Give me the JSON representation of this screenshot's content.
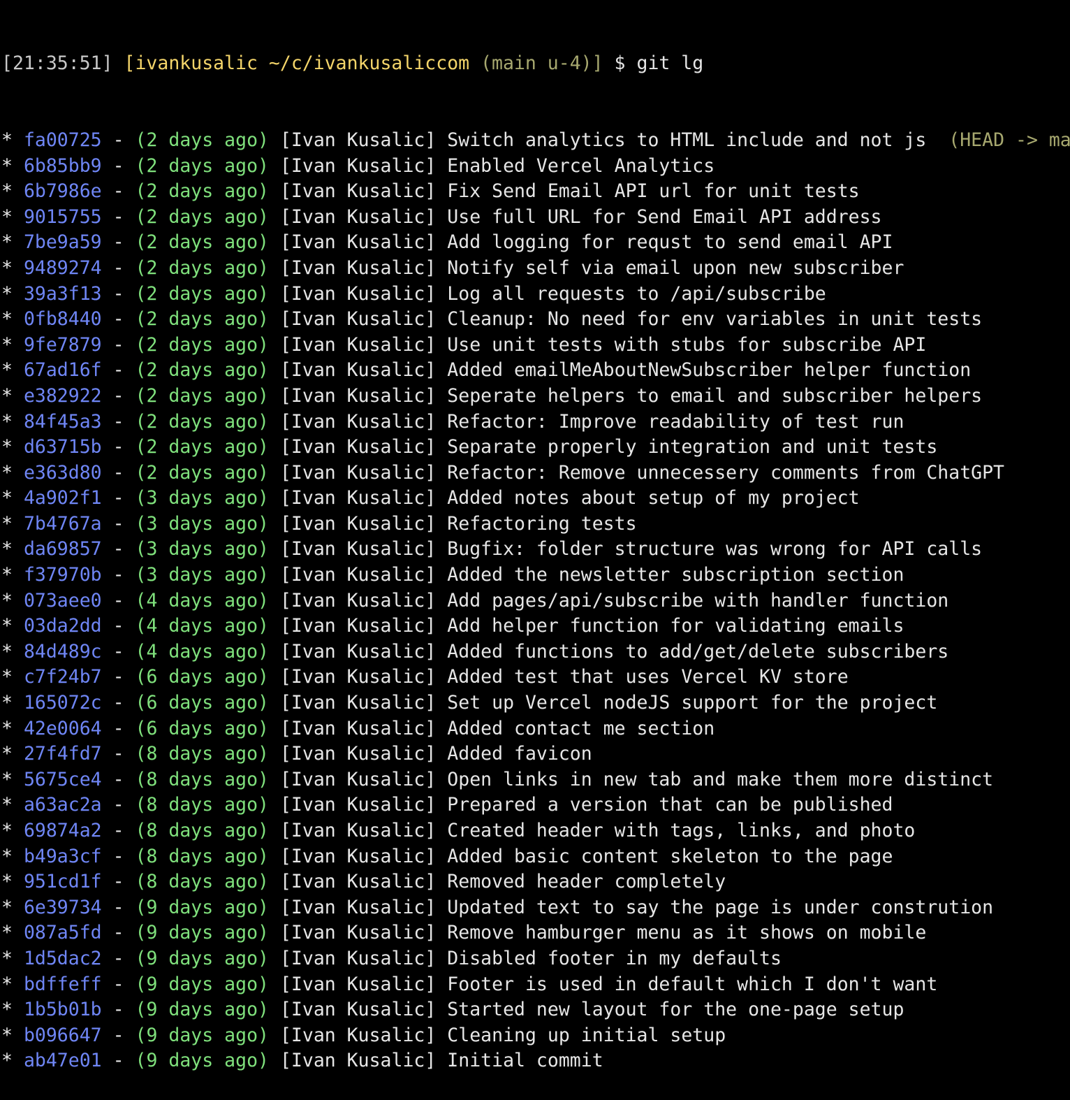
{
  "prompt": {
    "time": "[21:35:51]",
    "user_path": "[ivankusalic ~/c/ivankusaliccom",
    "branch": "(main u-4)]",
    "symbol": "$",
    "command": "git lg"
  },
  "commits": [
    {
      "graph": "*",
      "hash": "fa00725",
      "date": "(2 days ago)",
      "author": "[Ivan Kusalic]",
      "message": "Switch analytics to HTML include and not js",
      "refs": "(HEAD -> main)"
    },
    {
      "graph": "*",
      "hash": "6b85bb9",
      "date": "(2 days ago)",
      "author": "[Ivan Kusalic]",
      "message": "Enabled Vercel Analytics",
      "refs": ""
    },
    {
      "graph": "*",
      "hash": "6b7986e",
      "date": "(2 days ago)",
      "author": "[Ivan Kusalic]",
      "message": "Fix Send Email API url for unit tests",
      "refs": ""
    },
    {
      "graph": "*",
      "hash": "9015755",
      "date": "(2 days ago)",
      "author": "[Ivan Kusalic]",
      "message": "Use full URL for Send Email API address",
      "refs": ""
    },
    {
      "graph": "*",
      "hash": "7be9a59",
      "date": "(2 days ago)",
      "author": "[Ivan Kusalic]",
      "message": "Add logging for requst to send email API",
      "refs": ""
    },
    {
      "graph": "*",
      "hash": "9489274",
      "date": "(2 days ago)",
      "author": "[Ivan Kusalic]",
      "message": "Notify self via email upon new subscriber",
      "refs": ""
    },
    {
      "graph": "*",
      "hash": "39a3f13",
      "date": "(2 days ago)",
      "author": "[Ivan Kusalic]",
      "message": "Log all requests to /api/subscribe",
      "refs": ""
    },
    {
      "graph": "*",
      "hash": "0fb8440",
      "date": "(2 days ago)",
      "author": "[Ivan Kusalic]",
      "message": "Cleanup: No need for env variables in unit tests",
      "refs": ""
    },
    {
      "graph": "*",
      "hash": "9fe7879",
      "date": "(2 days ago)",
      "author": "[Ivan Kusalic]",
      "message": "Use unit tests with stubs for subscribe API",
      "refs": ""
    },
    {
      "graph": "*",
      "hash": "67ad16f",
      "date": "(2 days ago)",
      "author": "[Ivan Kusalic]",
      "message": "Added emailMeAboutNewSubscriber helper function",
      "refs": ""
    },
    {
      "graph": "*",
      "hash": "e382922",
      "date": "(2 days ago)",
      "author": "[Ivan Kusalic]",
      "message": "Seperate helpers to email and subscriber helpers",
      "refs": ""
    },
    {
      "graph": "*",
      "hash": "84f45a3",
      "date": "(2 days ago)",
      "author": "[Ivan Kusalic]",
      "message": "Refactor: Improve readability of test run",
      "refs": ""
    },
    {
      "graph": "*",
      "hash": "d63715b",
      "date": "(2 days ago)",
      "author": "[Ivan Kusalic]",
      "message": "Separate properly integration and unit tests",
      "refs": ""
    },
    {
      "graph": "*",
      "hash": "e363d80",
      "date": "(2 days ago)",
      "author": "[Ivan Kusalic]",
      "message": "Refactor: Remove unnecessery comments from ChatGPT",
      "refs": ""
    },
    {
      "graph": "*",
      "hash": "4a902f1",
      "date": "(3 days ago)",
      "author": "[Ivan Kusalic]",
      "message": "Added notes about setup of my project",
      "refs": ""
    },
    {
      "graph": "*",
      "hash": "7b4767a",
      "date": "(3 days ago)",
      "author": "[Ivan Kusalic]",
      "message": "Refactoring tests",
      "refs": ""
    },
    {
      "graph": "*",
      "hash": "da69857",
      "date": "(3 days ago)",
      "author": "[Ivan Kusalic]",
      "message": "Bugfix: folder structure was wrong for API calls",
      "refs": ""
    },
    {
      "graph": "*",
      "hash": "f37970b",
      "date": "(3 days ago)",
      "author": "[Ivan Kusalic]",
      "message": "Added the newsletter subscription section",
      "refs": ""
    },
    {
      "graph": "*",
      "hash": "073aee0",
      "date": "(4 days ago)",
      "author": "[Ivan Kusalic]",
      "message": "Add pages/api/subscribe with handler function",
      "refs": ""
    },
    {
      "graph": "*",
      "hash": "03da2dd",
      "date": "(4 days ago)",
      "author": "[Ivan Kusalic]",
      "message": "Add helper function for validating emails",
      "refs": ""
    },
    {
      "graph": "*",
      "hash": "84d489c",
      "date": "(4 days ago)",
      "author": "[Ivan Kusalic]",
      "message": "Added functions to add/get/delete subscribers",
      "refs": ""
    },
    {
      "graph": "*",
      "hash": "c7f24b7",
      "date": "(6 days ago)",
      "author": "[Ivan Kusalic]",
      "message": "Added test that uses Vercel KV store",
      "refs": ""
    },
    {
      "graph": "*",
      "hash": "165072c",
      "date": "(6 days ago)",
      "author": "[Ivan Kusalic]",
      "message": "Set up Vercel nodeJS support for the project",
      "refs": ""
    },
    {
      "graph": "*",
      "hash": "42e0064",
      "date": "(6 days ago)",
      "author": "[Ivan Kusalic]",
      "message": "Added contact me section",
      "refs": ""
    },
    {
      "graph": "*",
      "hash": "27f4fd7",
      "date": "(8 days ago)",
      "author": "[Ivan Kusalic]",
      "message": "Added favicon",
      "refs": ""
    },
    {
      "graph": "*",
      "hash": "5675ce4",
      "date": "(8 days ago)",
      "author": "[Ivan Kusalic]",
      "message": "Open links in new tab and make them more distinct",
      "refs": ""
    },
    {
      "graph": "*",
      "hash": "a63ac2a",
      "date": "(8 days ago)",
      "author": "[Ivan Kusalic]",
      "message": "Prepared a version that can be published",
      "refs": ""
    },
    {
      "graph": "*",
      "hash": "69874a2",
      "date": "(8 days ago)",
      "author": "[Ivan Kusalic]",
      "message": "Created header with tags, links, and photo",
      "refs": ""
    },
    {
      "graph": "*",
      "hash": "b49a3cf",
      "date": "(8 days ago)",
      "author": "[Ivan Kusalic]",
      "message": "Added basic content skeleton to the page",
      "refs": ""
    },
    {
      "graph": "*",
      "hash": "951cd1f",
      "date": "(8 days ago)",
      "author": "[Ivan Kusalic]",
      "message": "Removed header completely",
      "refs": ""
    },
    {
      "graph": "*",
      "hash": "6e39734",
      "date": "(9 days ago)",
      "author": "[Ivan Kusalic]",
      "message": "Updated text to say the page is under constrution",
      "refs": ""
    },
    {
      "graph": "*",
      "hash": "087a5fd",
      "date": "(9 days ago)",
      "author": "[Ivan Kusalic]",
      "message": "Remove hamburger menu as it shows on mobile",
      "refs": ""
    },
    {
      "graph": "*",
      "hash": "1d5dac2",
      "date": "(9 days ago)",
      "author": "[Ivan Kusalic]",
      "message": "Disabled footer in my defaults",
      "refs": ""
    },
    {
      "graph": "*",
      "hash": "bdffeff",
      "date": "(9 days ago)",
      "author": "[Ivan Kusalic]",
      "message": "Footer is used in default which I don't want",
      "refs": ""
    },
    {
      "graph": "*",
      "hash": "1b5b01b",
      "date": "(9 days ago)",
      "author": "[Ivan Kusalic]",
      "message": "Started new layout for the one-page setup",
      "refs": ""
    },
    {
      "graph": "*",
      "hash": "b096647",
      "date": "(9 days ago)",
      "author": "[Ivan Kusalic]",
      "message": "Cleaning up initial setup",
      "refs": ""
    },
    {
      "graph": "*",
      "hash": "ab47e01",
      "date": "(9 days ago)",
      "author": "[Ivan Kusalic]",
      "message": "Initial commit",
      "refs": ""
    }
  ],
  "colors": {
    "background": "#000000",
    "hash": "#6f86f5",
    "date": "#7fe07c",
    "text": "#e6e6e6",
    "prompt_user": "#f4d56a",
    "branch_ref": "#a7a86f"
  }
}
